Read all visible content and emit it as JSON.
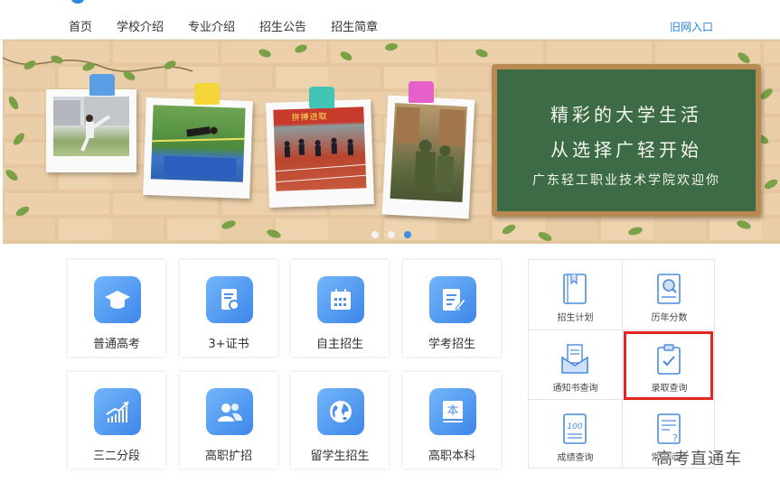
{
  "nav": {
    "items": [
      "首页",
      "学校介绍",
      "专业介绍",
      "招生公告",
      "招生简章"
    ],
    "old_site": "旧网入口"
  },
  "banner": {
    "line1": "精彩的大学生活",
    "line2": "从选择广轻开始",
    "line3": "广东轻工职业技术学院欢迎你",
    "photo3_sign": "拼搏进取",
    "active_slide": 3,
    "slide_count": 3
  },
  "tiles": [
    {
      "label": "普通高考",
      "icon": "graduation-cap-icon"
    },
    {
      "label": "3+证书",
      "icon": "certificate-icon"
    },
    {
      "label": "自主招生",
      "icon": "calendar-icon"
    },
    {
      "label": "学考招生",
      "icon": "edit-document-icon"
    },
    {
      "label": "三二分段",
      "icon": "growth-chart-icon"
    },
    {
      "label": "高职扩招",
      "icon": "users-icon"
    },
    {
      "label": "留学生招生",
      "icon": "globe-icon"
    },
    {
      "label": "高职本科",
      "icon": "book-icon"
    }
  ],
  "tile_badges": {
    "book": "本"
  },
  "queries": [
    {
      "label": "招生计划",
      "icon": "notebook-icon"
    },
    {
      "label": "历年分数",
      "icon": "search-document-icon"
    },
    {
      "label": "通知书查询",
      "icon": "envelope-letter-icon"
    },
    {
      "label": "录取查询",
      "icon": "clipboard-check-icon"
    },
    {
      "label": "成绩查询",
      "icon": "score-sheet-icon"
    },
    {
      "label": "常见问题",
      "icon": "question-document-icon"
    }
  ],
  "score_icon_text": "100",
  "watermark": "高考直通车",
  "colors": {
    "accent": "#3e86ea",
    "highlight": "#e0261e",
    "board": "#3d6b45"
  }
}
